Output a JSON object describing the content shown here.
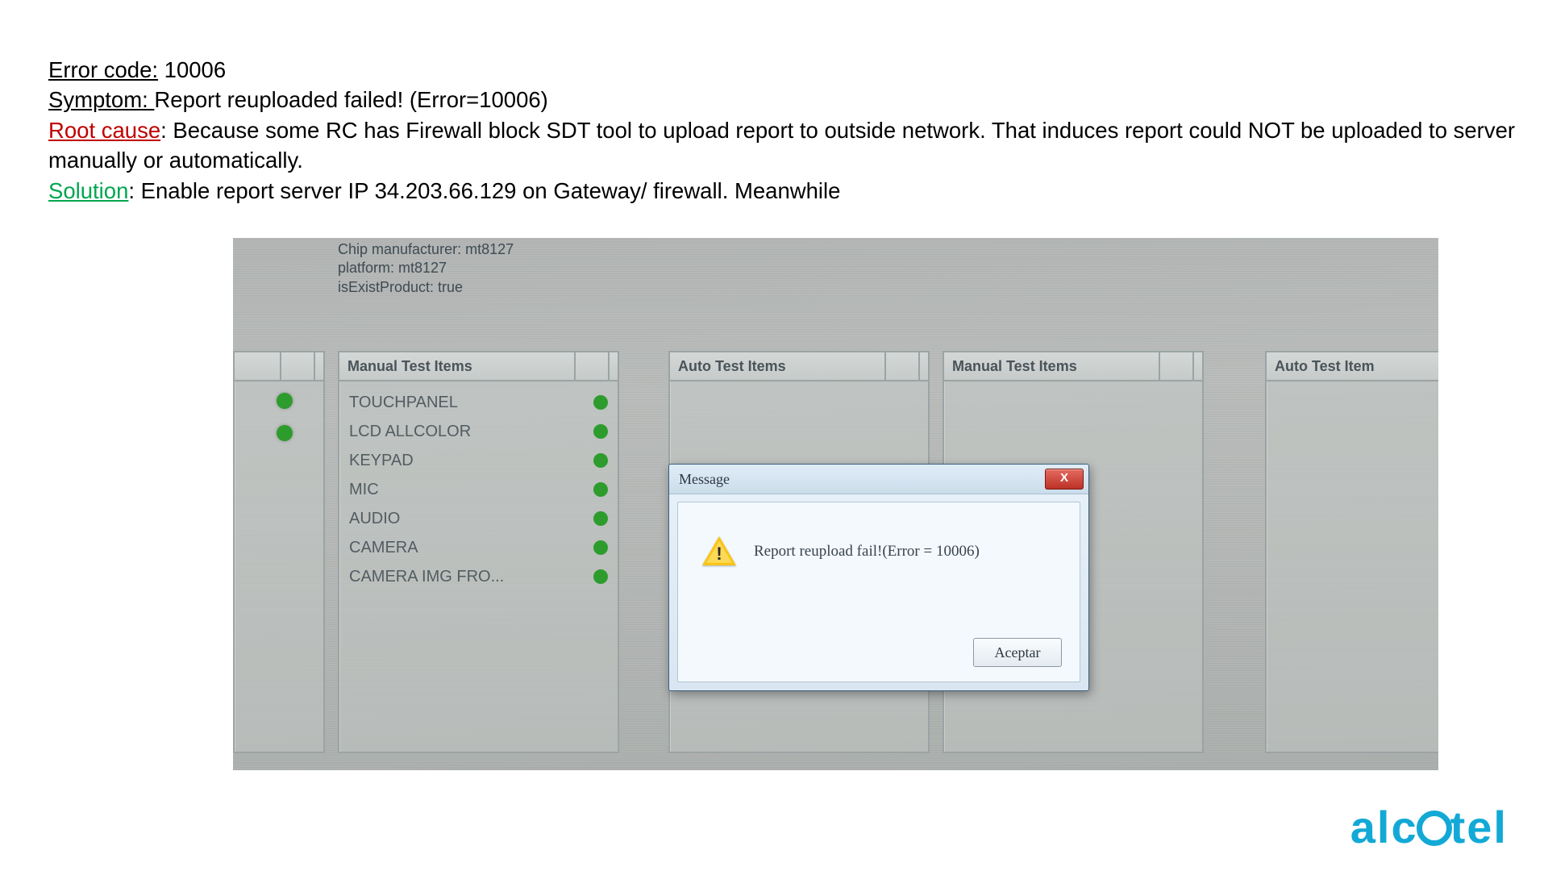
{
  "doc": {
    "error_code_label": "Error code:",
    "error_code_value": " 10006",
    "symptom_label": "Symptom: ",
    "symptom_value": "Report reuploaded failed! (Error=10006)",
    "root_cause_label": "Root cause",
    "root_cause_value": ": Because some RC has Firewall block SDT tool to upload report to outside network. That induces report could NOT be uploaded to server manually or automatically.",
    "solution_label": "Solution",
    "solution_value": ": Enable report server IP 34.203.66.129 on Gateway/ firewall. Meanwhile"
  },
  "device_info": {
    "line1": "Chip manufacturer: mt8127",
    "line2": "platform: mt8127",
    "line3": "isExistProduct: true"
  },
  "panels": {
    "manual1_header": "Manual Test Items",
    "auto1_header": "Auto Test Items",
    "manual2_header": "Manual Test Items",
    "auto2_header": "Auto Test Item"
  },
  "tests": {
    "items": [
      {
        "label": "TOUCHPANEL"
      },
      {
        "label": "LCD ALLCOLOR"
      },
      {
        "label": "KEYPAD"
      },
      {
        "label": "MIC"
      },
      {
        "label": "AUDIO"
      },
      {
        "label": "CAMERA"
      },
      {
        "label": "CAMERA IMG FRO..."
      }
    ]
  },
  "dialog": {
    "title": "Message",
    "close_glyph": "X",
    "message": "Report reupload fail!(Error = 10006)",
    "ok_label": "Aceptar"
  },
  "brand": {
    "text": "alcatel"
  }
}
